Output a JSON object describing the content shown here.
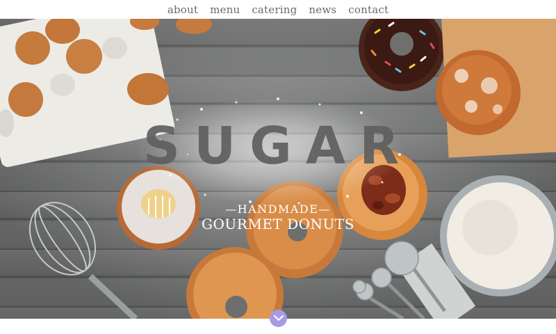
{
  "nav": {
    "items": [
      {
        "label": "about"
      },
      {
        "label": "menu"
      },
      {
        "label": "catering"
      },
      {
        "label": "news"
      },
      {
        "label": "contact"
      }
    ]
  },
  "hero": {
    "logo": "SUGAR",
    "tagline_top": "—HANDMADE—",
    "tagline_bottom": "GOURMET DONUTS"
  },
  "icons": {
    "scroll": "chevron-down-icon"
  },
  "colors": {
    "nav_text": "#6b6b6b",
    "scroll_button": "#a79be6",
    "wood": "#808281"
  }
}
